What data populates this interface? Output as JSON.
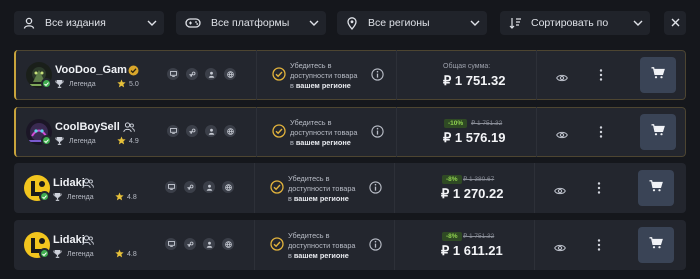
{
  "filters": {
    "publishers": {
      "label": "Все издания",
      "icon": "user-icon"
    },
    "platforms": {
      "label": "Все платформы",
      "icon": "gamepad-icon"
    },
    "regions": {
      "label": "Все регионы",
      "icon": "location-pin-icon"
    },
    "sort": {
      "label": "Сортировать по",
      "icon": "sort-icon"
    },
    "close_icon": "close-icon"
  },
  "colors": {
    "featured_border": "#c9a43c",
    "cart_button": "#3a4456",
    "discount_bg": "#2f4a24",
    "discount_text": "#8fd14f",
    "verified": "#3fae4f",
    "star": "#e7c13a",
    "check_circle": "#e2b33c"
  },
  "offers": [
    {
      "seller": "VooDoo_Gaming",
      "rank": "Легенда",
      "rating": "5.0",
      "featured": true,
      "name_mark": "gold-badge-icon",
      "avatar": "voodoo",
      "availability": {
        "line1": "Убедитесь в",
        "line2": "доступности товара",
        "prefix": "в",
        "region": "вашем регионе"
      },
      "price_caption": "Общая сумма:",
      "discount": "",
      "old_price": "",
      "price": "₽ 1 751.32"
    },
    {
      "seller": "CoolBoySell",
      "rank": "Легенда",
      "rating": "4.9",
      "featured": true,
      "name_mark": "users-icon",
      "avatar": "coolboy",
      "availability": {
        "line1": "Убедитесь в",
        "line2": "доступности товара",
        "prefix": "в",
        "region": "вашем регионе"
      },
      "price_caption": "",
      "discount": "-10%",
      "old_price": "₽ 1 751.32",
      "price": "₽ 1 576.19"
    },
    {
      "seller": "Lidaki",
      "rank": "Легенда",
      "rating": "4.8",
      "featured": false,
      "name_mark": "users-icon",
      "avatar": "lidaki",
      "availability": {
        "line1": "Убедитесь в",
        "line2": "доступности товара",
        "prefix": "в",
        "region": "вашем регионе"
      },
      "price_caption": "",
      "discount": "-8%",
      "old_price": "₽ 1 380.67",
      "price": "₽ 1 270.22"
    },
    {
      "seller": "Lidaki",
      "rank": "Легенда",
      "rating": "4.8",
      "featured": false,
      "name_mark": "users-icon",
      "avatar": "lidaki",
      "availability": {
        "line1": "Убедитесь в",
        "line2": "доступности товара",
        "prefix": "в",
        "region": "вашем регионе"
      },
      "price_caption": "",
      "discount": "-8%",
      "old_price": "₽ 1 751.32",
      "price": "₽ 1 611.21"
    }
  ],
  "platform_icons": [
    "pc-icon",
    "steam-icon",
    "account-icon",
    "globe-icon"
  ]
}
